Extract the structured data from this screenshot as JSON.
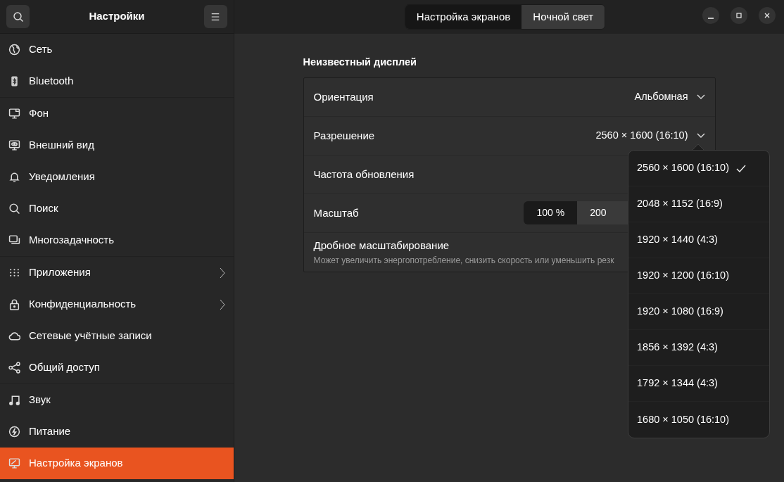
{
  "sidebar": {
    "title": "Настройки",
    "groups": [
      [
        {
          "label": "Сеть",
          "selected": false,
          "submenu": false
        },
        {
          "label": "Bluetooth",
          "selected": false,
          "submenu": false
        }
      ],
      [
        {
          "label": "Фон",
          "selected": false,
          "submenu": false
        },
        {
          "label": "Внешний вид",
          "selected": false,
          "submenu": false
        },
        {
          "label": "Уведомления",
          "selected": false,
          "submenu": false
        },
        {
          "label": "Поиск",
          "selected": false,
          "submenu": false
        },
        {
          "label": "Многозадачность",
          "selected": false,
          "submenu": false
        }
      ],
      [
        {
          "label": "Приложения",
          "selected": false,
          "submenu": true
        },
        {
          "label": "Конфиденциальность",
          "selected": false,
          "submenu": true
        },
        {
          "label": "Сетевые учётные записи",
          "selected": false,
          "submenu": false
        },
        {
          "label": "Общий доступ",
          "selected": false,
          "submenu": false
        }
      ],
      [
        {
          "label": "Звук",
          "selected": false,
          "submenu": false
        },
        {
          "label": "Питание",
          "selected": false,
          "submenu": false
        },
        {
          "label": "Настройка экранов",
          "selected": true,
          "submenu": false
        }
      ]
    ]
  },
  "tabs": [
    {
      "label": "Настройка экранов",
      "selected": true
    },
    {
      "label": "Ночной свет",
      "selected": false
    }
  ],
  "section_title": "Неизвестный дисплей",
  "rows": [
    {
      "kind": "dropdown",
      "label": "Ориентация",
      "value": "Альбомная"
    },
    {
      "kind": "dropdown",
      "label": "Разрешение",
      "value": "2560 × 1600 (16:10)"
    },
    {
      "kind": "plain",
      "label": "Частота обновления"
    },
    {
      "kind": "scale",
      "label": "Масштаб",
      "options": [
        {
          "label": "100 %",
          "selected": true
        },
        {
          "label": "200",
          "selected": false
        }
      ]
    },
    {
      "kind": "description",
      "label": "Дробное масштабирование",
      "subtitle": "Может увеличить энергопотребление, снизить скорость или уменьшить резк"
    }
  ],
  "popup": {
    "items": [
      {
        "label": "2560 × 1600 (16:10)",
        "selected": true
      },
      {
        "label": "2048 × 1152 (16:9)",
        "selected": false
      },
      {
        "label": "1920 × 1440 (4:3)",
        "selected": false
      },
      {
        "label": "1920 × 1200 (16:10)",
        "selected": false
      },
      {
        "label": "1920 × 1080 (16:9)",
        "selected": false
      },
      {
        "label": "1856 × 1392 (4:3)",
        "selected": false
      },
      {
        "label": "1792 × 1344 (4:3)",
        "selected": false
      },
      {
        "label": "1680 × 1050 (16:10)",
        "selected": false
      }
    ]
  }
}
